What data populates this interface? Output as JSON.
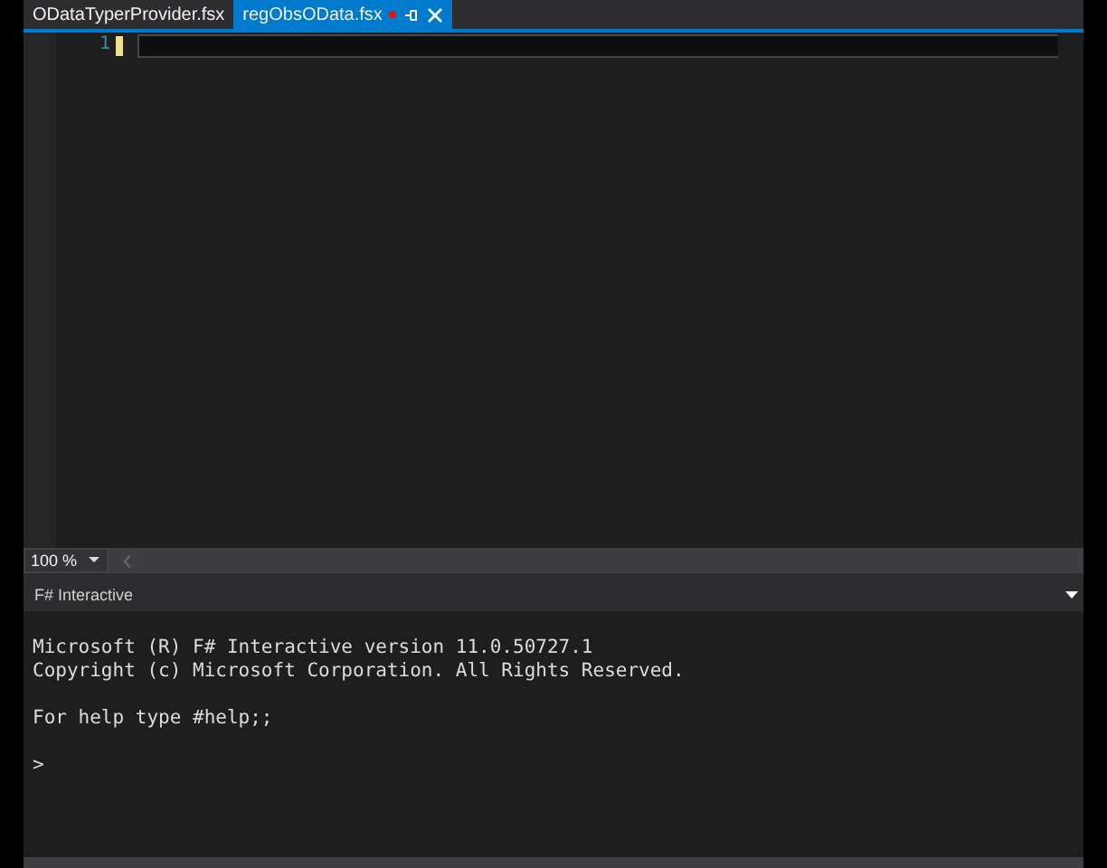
{
  "tabs": [
    {
      "label": "ODataTyperProvider.fsx",
      "selected": false,
      "modified": false
    },
    {
      "label": "regObsOData.fsx",
      "selected": true,
      "modified": true
    }
  ],
  "editor": {
    "line_numbers": [
      "1"
    ]
  },
  "zoom": {
    "value": "100 %"
  },
  "interactive": {
    "title": "F# Interactive",
    "blocks": [
      [
        "Microsoft (R) F# Interactive version 11.0.50727.1",
        "Copyright (c) Microsoft Corporation. All Rights Reserved."
      ],
      [
        "For help type #help;;"
      ]
    ],
    "prompt": ">"
  }
}
